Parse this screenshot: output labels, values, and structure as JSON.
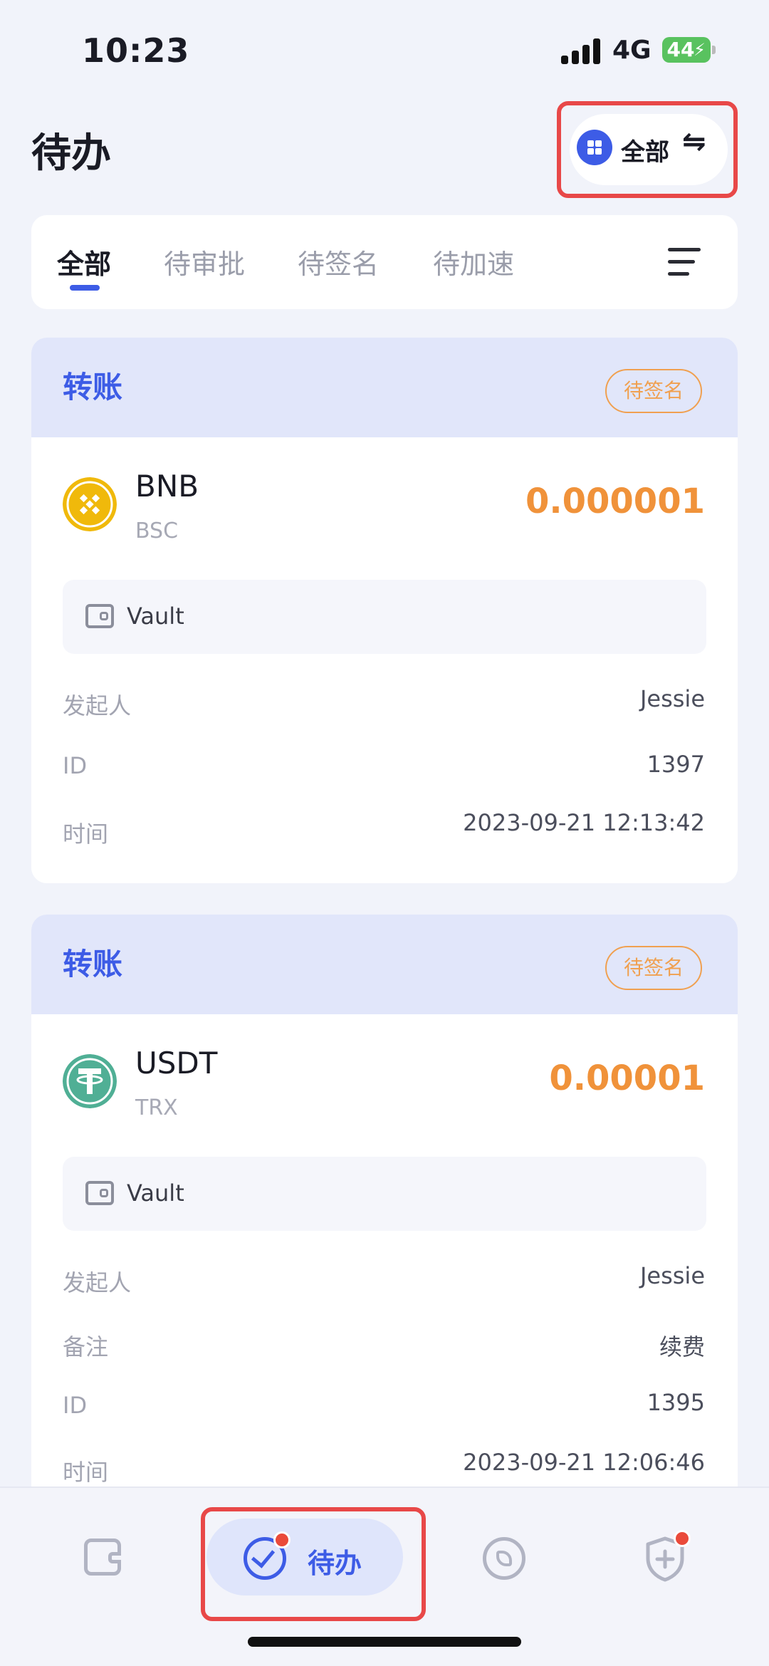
{
  "status": {
    "time": "10:23",
    "network": "4G",
    "battery": "44"
  },
  "header": {
    "title": "待办",
    "switch_label": "全部",
    "swap_icon": "swap-arrows-icon"
  },
  "tabs": [
    {
      "label": "全部",
      "active": true
    },
    {
      "label": "待审批",
      "active": false
    },
    {
      "label": "待签名",
      "active": false
    },
    {
      "label": "待加速",
      "active": false
    }
  ],
  "cards": [
    {
      "type": "转账",
      "badge": "待签名",
      "coin": "BNB",
      "chain": "BSC",
      "amount": "0.000001",
      "vault": "Vault",
      "rows": [
        {
          "label": "发起人",
          "value": "Jessie"
        },
        {
          "label": "ID",
          "value": "1397"
        },
        {
          "label": "时间",
          "value": "2023-09-21 12:13:42"
        }
      ]
    },
    {
      "type": "转账",
      "badge": "待签名",
      "coin": "USDT",
      "chain": "TRX",
      "amount": "0.00001",
      "vault": "Vault",
      "rows": [
        {
          "label": "发起人",
          "value": "Jessie"
        },
        {
          "label": "备注",
          "value": "续费"
        },
        {
          "label": "ID",
          "value": "1395"
        },
        {
          "label": "时间",
          "value": "2023-09-21 12:06:46"
        }
      ]
    }
  ],
  "bottom_nav": {
    "wallet_icon": "wallet-icon",
    "todo_label": "待办",
    "discover_icon": "compass-icon",
    "security_icon": "shield-plus-icon"
  },
  "colors": {
    "accent": "#3d5ce6",
    "amount": "#f0923a",
    "badge": "#f0a050",
    "highlight": "#e84848"
  }
}
